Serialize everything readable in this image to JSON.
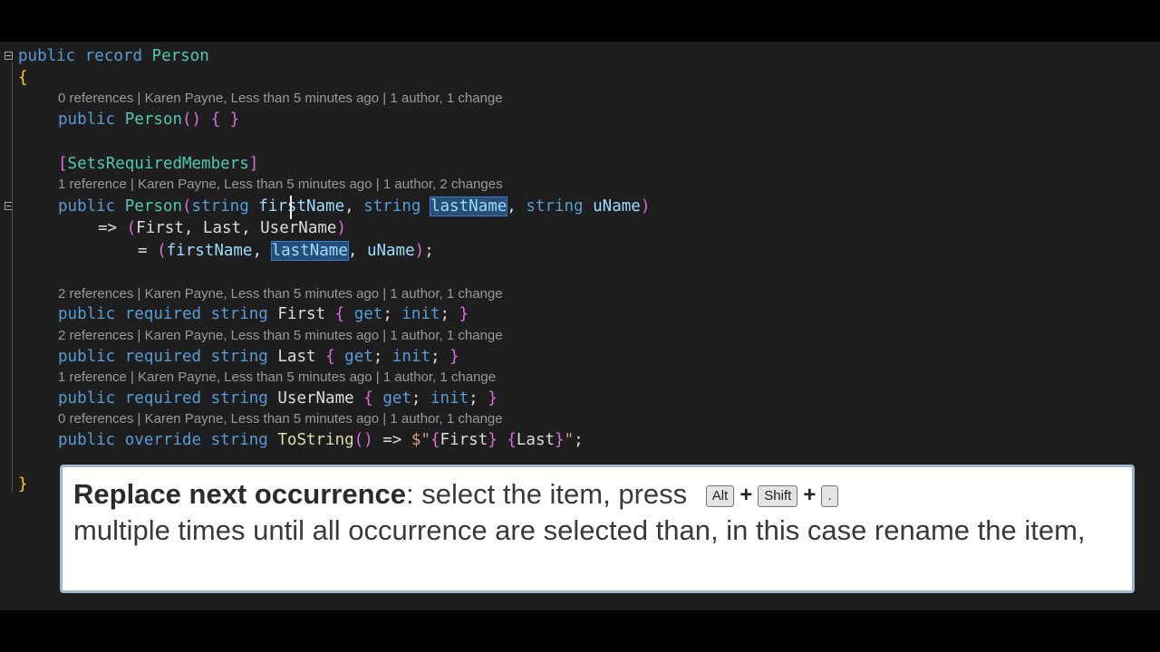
{
  "code": {
    "line1": {
      "kw1": "public",
      "kw2": "record",
      "type": "Person"
    },
    "open_brace": "{",
    "close_brace": "}",
    "lens1": "0 references | Karen Payne, Less than 5 minutes ago | 1 author, 1 change",
    "ctor1": {
      "kw": "public",
      "name": "Person",
      "parens": "()",
      "body": "{ }"
    },
    "attribute": {
      "open": "[",
      "name": "SetsRequiredMembers",
      "close": "]"
    },
    "lens2": "1 reference | Karen Payne, Less than 5 minutes ago | 1 author, 2 changes",
    "ctor2": {
      "kw": "public",
      "name": "Person",
      "open": "(",
      "t1": "string",
      "p1": "firstName",
      "c1": ",",
      "t2": "string",
      "p2": "lastName",
      "c2": ",",
      "t3": "string",
      "p3": "uName",
      "close": ")"
    },
    "arrow_line": {
      "arrow": "=>",
      "open": "(",
      "body": "First, Last, UserName",
      "close": ")"
    },
    "assign_line": {
      "eq": "=",
      "open": "(",
      "a1": "firstName",
      "c1": ",",
      "a2": "lastName",
      "c2": ",",
      "a3": "uName",
      "close": ")",
      "semi": ";"
    },
    "lens3": "2 references | Karen Payne, Less than 5 minutes ago | 1 author, 1 change",
    "prop_first": {
      "kw1": "public",
      "kw2": "required",
      "kw3": "string",
      "name": "First",
      "open": "{",
      "get": "get",
      "init": "init",
      "close": "}"
    },
    "lens4": "2 references | Karen Payne, Less than 5 minutes ago | 1 author, 1 change",
    "prop_last": {
      "kw1": "public",
      "kw2": "required",
      "kw3": "string",
      "name": "Last",
      "open": "{",
      "get": "get",
      "init": "init",
      "close": "}"
    },
    "lens5": "1 reference | Karen Payne, Less than 5 minutes ago | 1 author, 1 change",
    "prop_user": {
      "kw1": "public",
      "kw2": "required",
      "kw3": "string",
      "name": "UserName",
      "open": "{",
      "get": "get",
      "init": "init",
      "close": "}"
    },
    "lens6": "0 references | Karen Payne, Less than 5 minutes ago | 1 author, 1 change",
    "tostring": {
      "kw1": "public",
      "kw2": "override",
      "kw3": "string",
      "name": "ToString",
      "parens": "()",
      "arrow": "=>",
      "str_open": "$\"",
      "b1o": "{",
      "v1": "First",
      "b1c": "}",
      "b2o": "{",
      "v2": "Last",
      "b2c": "}",
      "str_close": "\"",
      "semi": ";"
    }
  },
  "tip": {
    "bold": "Replace next occurrence",
    "text1": ": select the item, press",
    "key1": "Alt",
    "plus": "+",
    "key2": "Shift",
    "key3": ".",
    "text2": "multiple times until all occurrence are selected than, in this case rename the item,"
  },
  "colors": {
    "editor_bg": "#1e1e1e",
    "keyword": "#569cd6",
    "type": "#4ec9b0",
    "selection": "#264f78"
  }
}
